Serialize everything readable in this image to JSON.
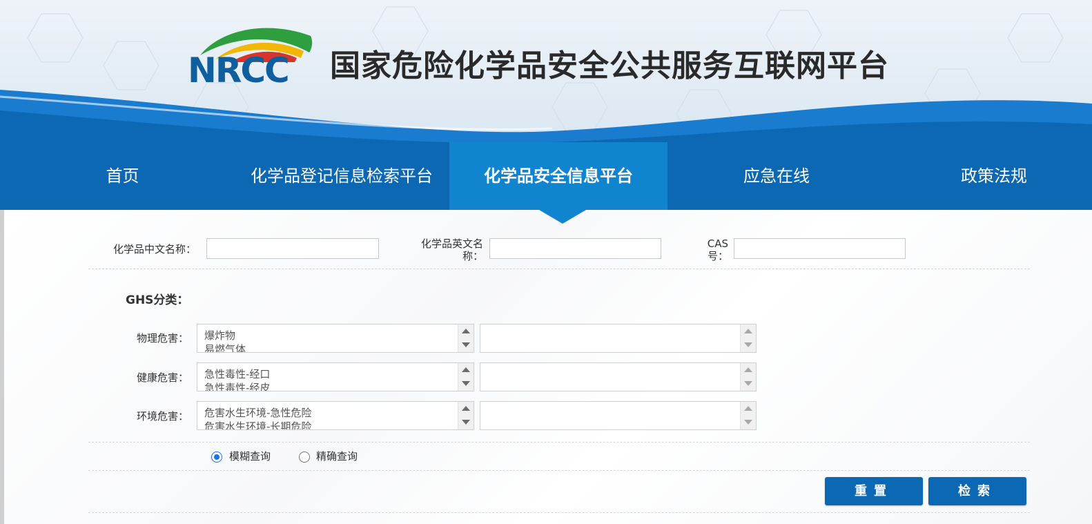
{
  "header": {
    "logo_text": "NRCC",
    "site_title": "国家危险化学品安全公共服务互联网平台"
  },
  "nav": {
    "items": [
      {
        "label": "首页"
      },
      {
        "label": "化学品登记信息检索平台"
      },
      {
        "label": "化学品安全信息平台"
      },
      {
        "label": "应急在线"
      },
      {
        "label": "政策法规"
      }
    ],
    "active": "化学品安全信息平台"
  },
  "search": {
    "cn_name_label": "化学品中文名称：",
    "cn_name_value": "",
    "en_name_label_line1": "化学品英文名",
    "en_name_label_line2": "称：",
    "en_name_value": "",
    "cas_label_line1": "CAS",
    "cas_label_line2": "号：",
    "cas_value": ""
  },
  "ghs": {
    "title": "GHS分类：",
    "rows": [
      {
        "label": "物理危害：",
        "options": [
          "爆炸物",
          "易燃气体"
        ]
      },
      {
        "label": "健康危害：",
        "options": [
          "急性毒性-经口",
          "急性毒性-经皮"
        ]
      },
      {
        "label": "环境危害：",
        "options": [
          "危害水生环境-急性危险",
          "危害水生环境-长期危险"
        ]
      }
    ]
  },
  "query_mode": {
    "fuzzy_label": "模糊查询",
    "exact_label": "精确查询",
    "selected": "模糊查询"
  },
  "actions": {
    "reset_label": "重置",
    "search_label": "检索"
  },
  "colors": {
    "nav_bg": "#0d68b3",
    "nav_active": "#1184d0",
    "button_bg": "#0d68b3",
    "logo_blue": "#0f5e9e"
  }
}
